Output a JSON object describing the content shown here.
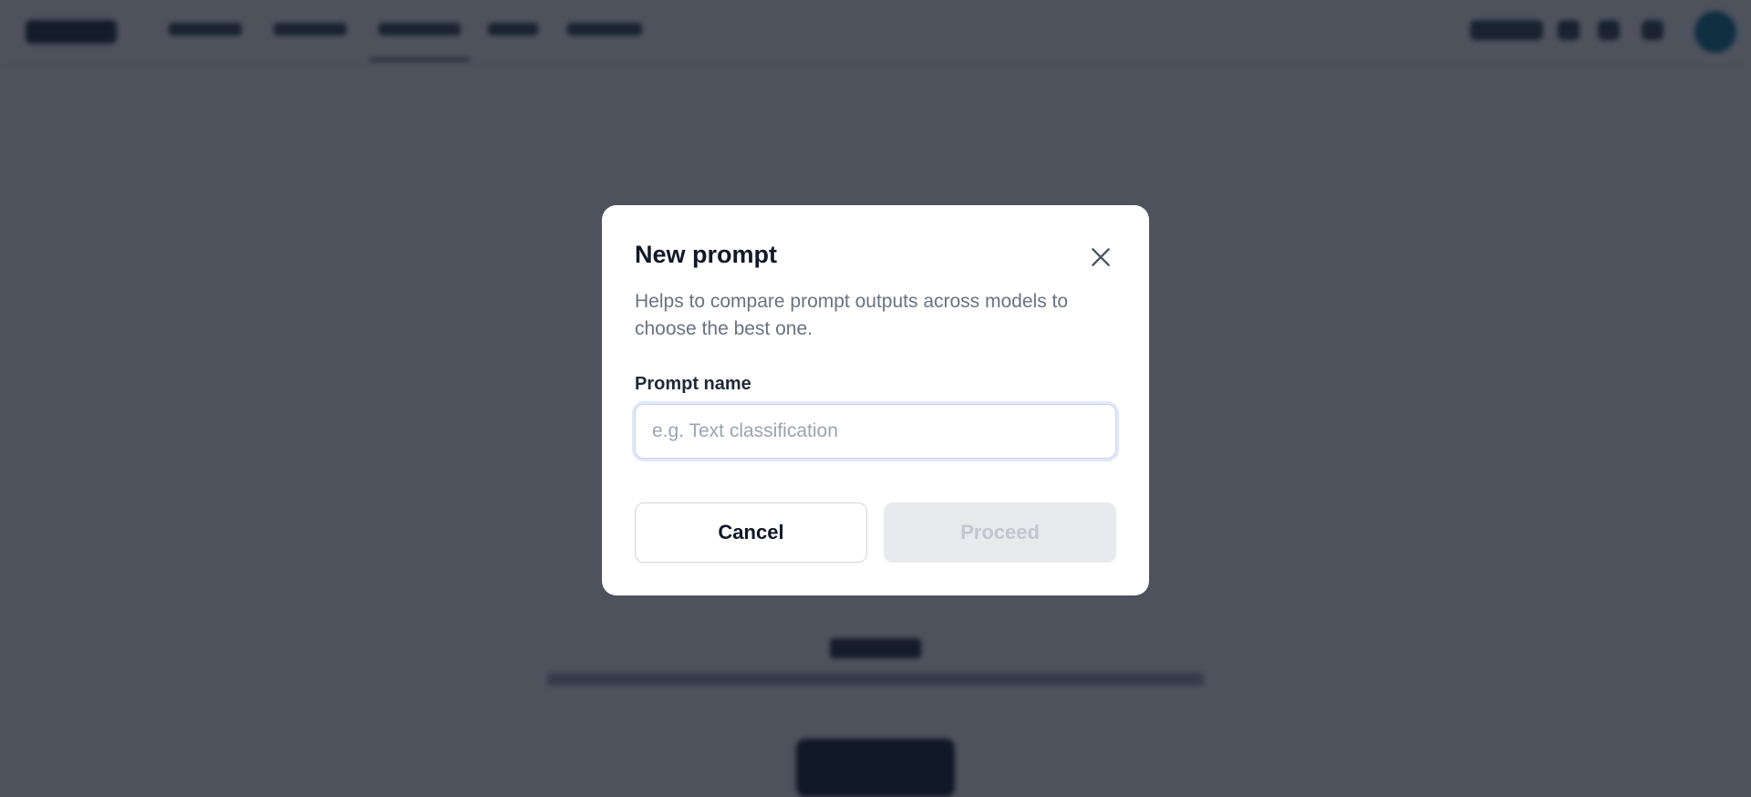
{
  "modal": {
    "title": "New prompt",
    "description": "Helps to compare prompt outputs across models to choose the best one.",
    "field_label": "Prompt name",
    "input_value": "",
    "input_placeholder": "e.g. Text classification",
    "cancel_label": "Cancel",
    "proceed_label": "Proceed",
    "close_icon": "close-icon"
  },
  "colors": {
    "overlay": "#111827",
    "title": "#111827",
    "description": "#6b7280",
    "proceed_disabled_bg": "#e9eaee",
    "proceed_disabled_text": "#c2c6cf"
  }
}
